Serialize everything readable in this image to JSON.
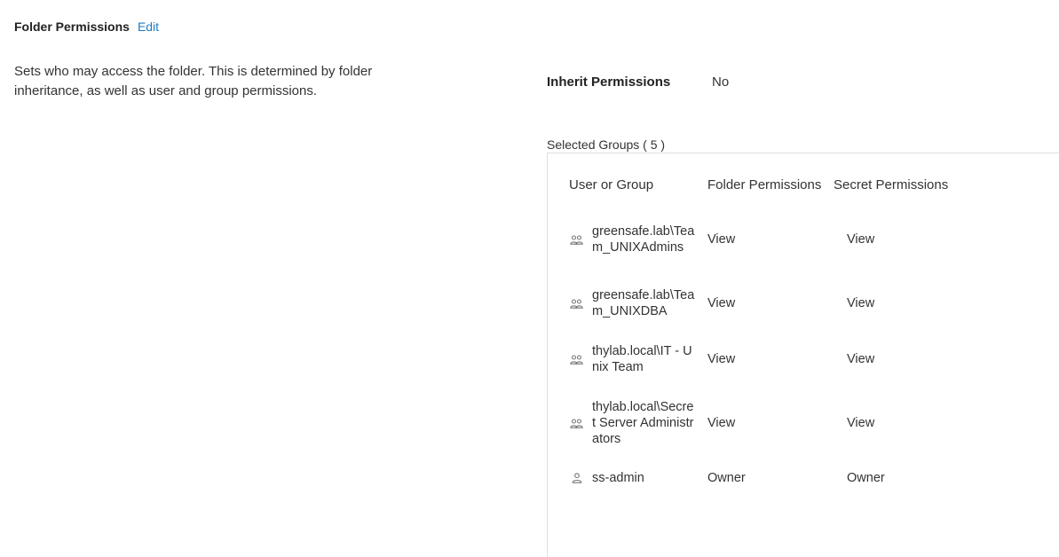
{
  "folder_permissions": {
    "title": "Folder Permissions",
    "edit_label": "Edit",
    "description": "Sets who may access the folder. This is determined by folder inheritance, as well as user and group permissions."
  },
  "inherit": {
    "label": "Inherit Permissions",
    "value": "No"
  },
  "groups_heading": "Selected Groups ( 5 )",
  "table": {
    "headers": {
      "user_or_group": "User or Group",
      "folder_permissions": "Folder Permissions",
      "secret_permissions": "Secret Permissions"
    },
    "rows": [
      {
        "icon": "group-icon",
        "name": "greensafe.lab\\Team_UNIXAdmins",
        "folder_permission": "View",
        "secret_permission": "View"
      },
      {
        "icon": "group-icon",
        "name": "greensafe.lab\\Team_UNIXDBA",
        "folder_permission": "View",
        "secret_permission": "View"
      },
      {
        "icon": "group-icon",
        "name": "thylab.local\\IT - Unix Team",
        "folder_permission": "View",
        "secret_permission": "View"
      },
      {
        "icon": "group-icon",
        "name": "thylab.local\\Secret Server Administrators",
        "folder_permission": "View",
        "secret_permission": "View"
      },
      {
        "icon": "user-icon",
        "name": "ss-admin",
        "folder_permission": "Owner",
        "secret_permission": "Owner"
      }
    ]
  },
  "colors": {
    "link": "#1e7bc4",
    "text": "#333333",
    "border": "#e0e0e0"
  }
}
